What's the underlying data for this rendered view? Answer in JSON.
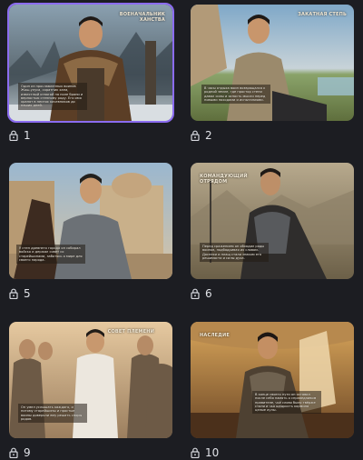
{
  "cards": [
    {
      "number": "1",
      "title": "ВОЕНАЧАЛЬНИК ХАНСТВА",
      "text": "Один из прославленных воинов Жош-улуса, соратник хана, известный отвагой на поле брани и верностью степному роду. Его имя хранят в песнях кочевников до наших дней.",
      "selected": true
    },
    {
      "number": "2",
      "title": "ЗАКАТНАЯ СТЕПЬ",
      "text": "В часы отдыха воин возвращался к родной земле, где простор степи давал силы и ясность мысли перед новыми походами и испытаниями.",
      "selected": false
    },
    {
      "number": "5",
      "title": "",
      "text": "У стен древнего города он собирал войско и держал совет со старейшинами, заботясь о мире для своего народа.",
      "selected": false
    },
    {
      "number": "6",
      "title": "КОМАНДУЮЩИЙ ОТРЯДОМ",
      "text": "Перед сражением он обходил ряды воинов, подбадривая их словом. Доспехи и плащ стали знаком его решимости и силы духа.",
      "selected": false
    },
    {
      "number": "9",
      "title": "СОВЕТ ПЛЕМЕНИ",
      "text": "Он умел услышать каждого, и потому старейшины и простые воины доверяли ему решать споры родов.",
      "selected": false
    },
    {
      "number": "10",
      "title": "НАСЛЕДИЕ",
      "text": "В конце своего пути он оставил после себя память о справедливом правителе, чьё слово было твёрже стали и чья щедрость кормила целые аулы.",
      "selected": false
    }
  ]
}
